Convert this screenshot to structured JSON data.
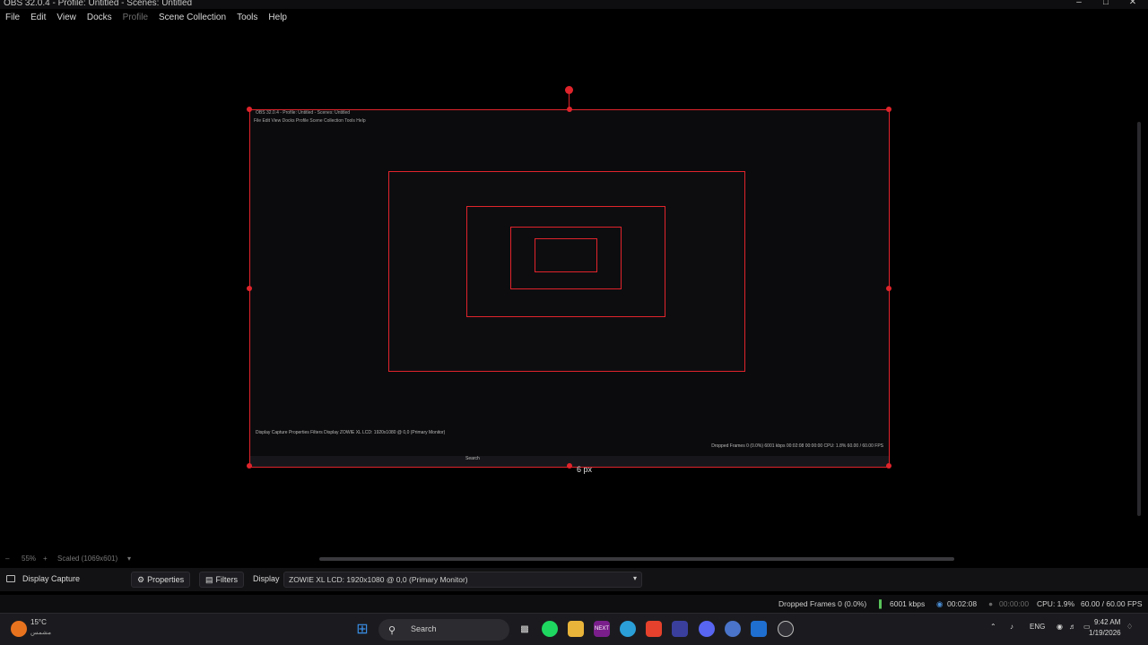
{
  "window": {
    "title": "OBS 32.0.4 - Profile: Untitled - Scenes: Untitled",
    "controls": {
      "minimize": "–",
      "maximize": "□",
      "close": "✕"
    }
  },
  "menu": {
    "file": "File",
    "edit": "Edit",
    "view": "View",
    "docks": "Docks",
    "profile": "Profile",
    "scene_collection": "Scene Collection",
    "tools": "Tools",
    "help": "Help"
  },
  "preview": {
    "resize_readout": "6 px",
    "nested_title": "OBS 32.0.4 - Profile: Untitled - Scenes: Untitled",
    "nested_menu": "File  Edit  View  Docks  Profile  Scene Collection  Tools  Help",
    "nested_sourcebar": "Display Capture     Properties   Filters   Display   ZOWIE XL LCD: 1920x1080 @ 0,0 (Primary Monitor)",
    "nested_status": "Dropped Frames 0 (0.0%)   6001 kbps   00:02:08   00:00:00   CPU: 1.8%   60.00 / 60.00 FPS",
    "nested_taskbar": "Search"
  },
  "zoom": {
    "percent": "55%",
    "scaled_label": "Scaled (1069x601)"
  },
  "sourcebar": {
    "source_name": "Display Capture",
    "properties": "Properties",
    "filters": "Filters",
    "display_label": "Display",
    "display_value": "ZOWIE XL LCD: 1920x1080 @ 0,0 (Primary Monitor)"
  },
  "status": {
    "dropped_frames": "Dropped Frames 0 (0.0%)",
    "bitrate": "6001 kbps",
    "stream_time": "00:02:08",
    "record_time": "00:00:00",
    "cpu": "CPU: 1.9%",
    "fps": "60.00 / 60.00 FPS"
  },
  "taskbar": {
    "weather_temp": "15°C",
    "weather_desc": "مشمس",
    "search_label": "Search",
    "language": "ENG",
    "time": "9:42 AM",
    "date": "1/19/2026"
  },
  "colors": {
    "selection": "#e0242b",
    "background": "#000000",
    "panel": "#121214"
  }
}
